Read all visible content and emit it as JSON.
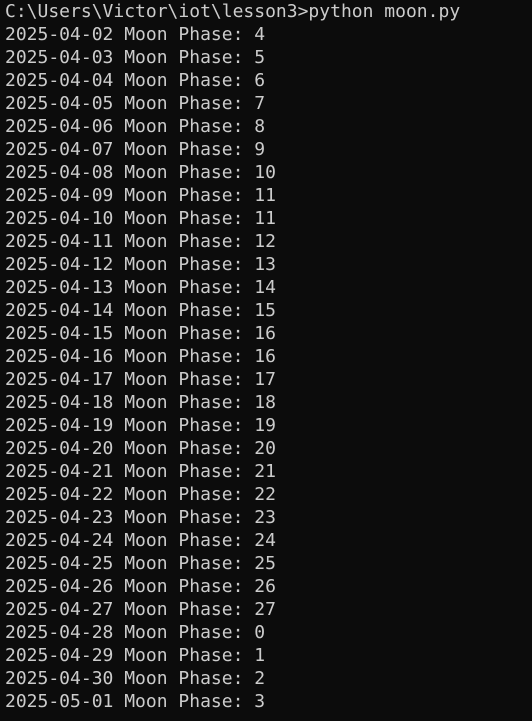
{
  "terminal": {
    "command_line": "C:\\Users\\Victor\\iot\\lesson3>python moon.py",
    "output_lines": [
      "2025-04-02 Moon Phase: 4",
      "2025-04-03 Moon Phase: 5",
      "2025-04-04 Moon Phase: 6",
      "2025-04-05 Moon Phase: 7",
      "2025-04-06 Moon Phase: 8",
      "2025-04-07 Moon Phase: 9",
      "2025-04-08 Moon Phase: 10",
      "2025-04-09 Moon Phase: 11",
      "2025-04-10 Moon Phase: 11",
      "2025-04-11 Moon Phase: 12",
      "2025-04-12 Moon Phase: 13",
      "2025-04-13 Moon Phase: 14",
      "2025-04-14 Moon Phase: 15",
      "2025-04-15 Moon Phase: 16",
      "2025-04-16 Moon Phase: 16",
      "2025-04-17 Moon Phase: 17",
      "2025-04-18 Moon Phase: 18",
      "2025-04-19 Moon Phase: 19",
      "2025-04-20 Moon Phase: 20",
      "2025-04-21 Moon Phase: 21",
      "2025-04-22 Moon Phase: 22",
      "2025-04-23 Moon Phase: 23",
      "2025-04-24 Moon Phase: 24",
      "2025-04-25 Moon Phase: 25",
      "2025-04-26 Moon Phase: 26",
      "2025-04-27 Moon Phase: 27",
      "2025-04-28 Moon Phase: 0",
      "2025-04-29 Moon Phase: 1",
      "2025-04-30 Moon Phase: 2",
      "2025-05-01 Moon Phase: 3"
    ]
  },
  "colors": {
    "background": "#0c0c0c",
    "text": "#cccccc"
  }
}
